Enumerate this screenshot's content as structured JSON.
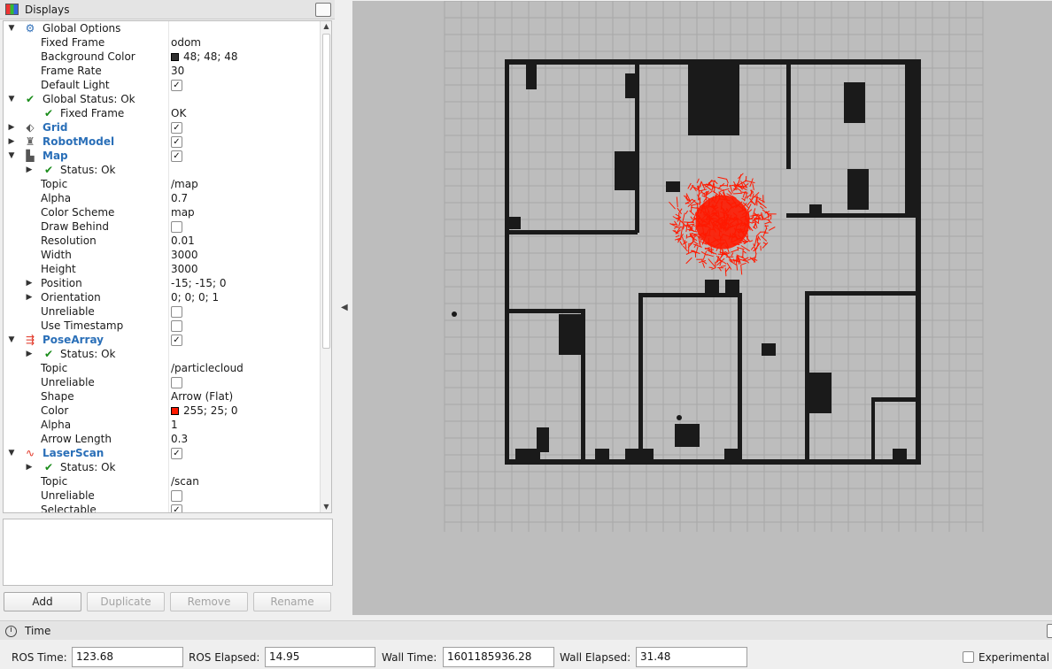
{
  "displays_panel": {
    "title": "Displays",
    "rows": [
      {
        "depth": 0,
        "arrow": "down",
        "icon": "gear-icon",
        "name": "Global Options",
        "bold": false
      },
      {
        "depth": 1,
        "arrow": "",
        "icon": "",
        "name": "Fixed Frame",
        "value": "odom"
      },
      {
        "depth": 1,
        "arrow": "",
        "icon": "",
        "name": "Background Color",
        "swatch": "#303030",
        "value": "48; 48; 48"
      },
      {
        "depth": 1,
        "arrow": "",
        "icon": "",
        "name": "Frame Rate",
        "value": "30"
      },
      {
        "depth": 1,
        "arrow": "",
        "icon": "",
        "name": "Default Light",
        "checkbox": true
      },
      {
        "depth": 0,
        "arrow": "down",
        "icon": "check-icon",
        "name": "Global Status: Ok"
      },
      {
        "depth": 2,
        "arrow": "",
        "icon": "check-icon",
        "name": "Fixed Frame",
        "value": "OK"
      },
      {
        "depth": 0,
        "arrow": "right",
        "icon": "grid-icon",
        "name": "Grid",
        "bold": true,
        "checkbox": true
      },
      {
        "depth": 0,
        "arrow": "right",
        "icon": "robot-icon",
        "name": "RobotModel",
        "bold": true,
        "checkbox": true
      },
      {
        "depth": 0,
        "arrow": "down",
        "icon": "map-icon",
        "name": "Map",
        "bold": true,
        "checkbox": true
      },
      {
        "depth": 1,
        "arrow": "right",
        "icon": "check-icon",
        "name": "Status: Ok"
      },
      {
        "depth": 1,
        "arrow": "",
        "icon": "",
        "name": "Topic",
        "value": "/map"
      },
      {
        "depth": 1,
        "arrow": "",
        "icon": "",
        "name": "Alpha",
        "value": "0.7"
      },
      {
        "depth": 1,
        "arrow": "",
        "icon": "",
        "name": "Color Scheme",
        "value": "map"
      },
      {
        "depth": 1,
        "arrow": "",
        "icon": "",
        "name": "Draw Behind",
        "checkbox": false
      },
      {
        "depth": 1,
        "arrow": "",
        "icon": "",
        "name": "Resolution",
        "value": "0.01"
      },
      {
        "depth": 1,
        "arrow": "",
        "icon": "",
        "name": "Width",
        "value": "3000"
      },
      {
        "depth": 1,
        "arrow": "",
        "icon": "",
        "name": "Height",
        "value": "3000"
      },
      {
        "depth": 1,
        "arrow": "right",
        "icon": "",
        "name": "Position",
        "value": "-15; -15; 0"
      },
      {
        "depth": 1,
        "arrow": "right",
        "icon": "",
        "name": "Orientation",
        "value": "0; 0; 0; 1"
      },
      {
        "depth": 1,
        "arrow": "",
        "icon": "",
        "name": "Unreliable",
        "checkbox": false
      },
      {
        "depth": 1,
        "arrow": "",
        "icon": "",
        "name": "Use Timestamp",
        "checkbox": false
      },
      {
        "depth": 0,
        "arrow": "down",
        "icon": "posearray-icon",
        "name": "PoseArray",
        "bold": true,
        "checkbox": true
      },
      {
        "depth": 1,
        "arrow": "right",
        "icon": "check-icon",
        "name": "Status: Ok"
      },
      {
        "depth": 1,
        "arrow": "",
        "icon": "",
        "name": "Topic",
        "value": "/particlecloud"
      },
      {
        "depth": 1,
        "arrow": "",
        "icon": "",
        "name": "Unreliable",
        "checkbox": false
      },
      {
        "depth": 1,
        "arrow": "",
        "icon": "",
        "name": "Shape",
        "value": "Arrow (Flat)"
      },
      {
        "depth": 1,
        "arrow": "",
        "icon": "",
        "name": "Color",
        "swatch": "#ff1900",
        "value": "255; 25; 0"
      },
      {
        "depth": 1,
        "arrow": "",
        "icon": "",
        "name": "Alpha",
        "value": "1"
      },
      {
        "depth": 1,
        "arrow": "",
        "icon": "",
        "name": "Arrow Length",
        "value": "0.3"
      },
      {
        "depth": 0,
        "arrow": "down",
        "icon": "laserscan-icon",
        "name": "LaserScan",
        "bold": true,
        "checkbox": true
      },
      {
        "depth": 1,
        "arrow": "right",
        "icon": "check-icon",
        "name": "Status: Ok"
      },
      {
        "depth": 1,
        "arrow": "",
        "icon": "",
        "name": "Topic",
        "value": "/scan"
      },
      {
        "depth": 1,
        "arrow": "",
        "icon": "",
        "name": "Unreliable",
        "checkbox": false
      },
      {
        "depth": 1,
        "arrow": "",
        "icon": "",
        "name": "Selectable",
        "checkbox": true
      }
    ],
    "buttons": {
      "add": "Add",
      "duplicate": "Duplicate",
      "remove": "Remove",
      "rename": "Rename"
    }
  },
  "view": {
    "background": "#bdbdbd",
    "particle_color": "#ff1900"
  },
  "time_panel": {
    "title": "Time",
    "ros_time_label": "ROS Time:",
    "ros_time": "123.68",
    "ros_elapsed_label": "ROS Elapsed:",
    "ros_elapsed": "14.95",
    "wall_time_label": "Wall Time:",
    "wall_time": "1601185936.28",
    "wall_elapsed_label": "Wall Elapsed:",
    "wall_elapsed": "31.48",
    "experimental_label": "Experimental"
  }
}
